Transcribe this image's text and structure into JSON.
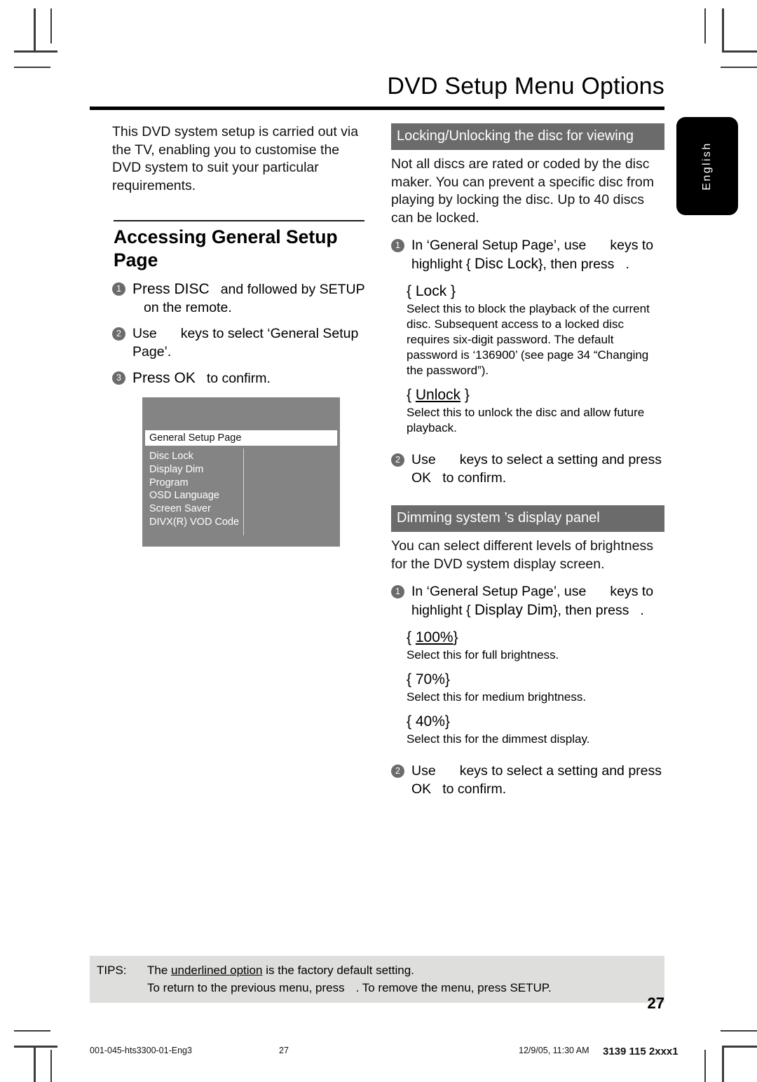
{
  "header": {
    "title": "DVD Setup Menu Options"
  },
  "language_tab": {
    "label": "English"
  },
  "left_column": {
    "intro": "This DVD system setup is carried out via the TV, enabling you to customise the DVD system to suit your particular requirements.",
    "section_heading": "Accessing General Setup Page",
    "steps": [
      {
        "num": "1",
        "pre": "Press DISC",
        "mid": "and followed by SETUP",
        "post": "on the remote."
      },
      {
        "num": "2",
        "pre": "Use",
        "mid": "",
        "post": "keys to select ‘General Setup Page’."
      },
      {
        "num": "3",
        "pre": "Press OK",
        "mid": "",
        "post": "to confirm."
      }
    ]
  },
  "osd_screen": {
    "title": "General Setup Page",
    "items": [
      "Disc Lock",
      "Display Dim",
      "Program",
      "OSD Language",
      "Screen Saver",
      "DIVX(R) VOD Code"
    ]
  },
  "right_column": {
    "section_lock": {
      "banner": "Locking/Unlocking the disc for viewing",
      "intro": "Not all discs are rated or coded by the disc maker. You can prevent a specific disc from playing by locking the disc.  Up to 40 discs can be locked.",
      "step1_a": "In ‘General Setup Page’, use",
      "step1_b": "keys to highlight {",
      "step1_key": "Disc Lock",
      "step1_c": "}, then press",
      "step1_d": ".",
      "options": [
        {
          "label": "Lock",
          "underlined": false,
          "desc": "Select this to block the playback of the current disc.  Subsequent access to a locked disc requires six-digit password. The default password is ‘136900’ (see page 34 “Changing the password”)."
        },
        {
          "label": "Unlock",
          "underlined": true,
          "desc": "Select this to unlock the disc and allow future playback."
        }
      ],
      "step2_a": "Use",
      "step2_b": "keys to select a setting and press OK",
      "step2_c": "to confirm."
    },
    "section_dim": {
      "banner": "Dimming system ’s display panel",
      "intro": "You can select different levels of brightness for the DVD system display screen.",
      "step1_a": "In ‘General Setup Page’, use",
      "step1_b": "keys to highlight {",
      "step1_key": "Display Dim",
      "step1_c": "}, then press",
      "step1_d": ".",
      "options": [
        {
          "label": "100%",
          "underlined": true,
          "desc": "Select this for full brightness."
        },
        {
          "label": "70%",
          "underlined": false,
          "desc": "Select this for medium brightness."
        },
        {
          "label": "40%",
          "underlined": false,
          "desc": "Select this for the dimmest display."
        }
      ],
      "step2_a": "Use",
      "step2_b": "keys to select a setting and press OK",
      "step2_c": "to confirm."
    }
  },
  "tips": {
    "label": "TIPS:",
    "line1_a": "The",
    "line1_underlined": "underlined option",
    "line1_b": "is the factory default setting.",
    "line2_a": "To return to the previous menu, press",
    "line2_b": ". To remove the menu, press SETUP",
    "line2_c": "."
  },
  "page_number": "27",
  "footer": {
    "file_name": "001-045-hts3300-01-Eng3",
    "page": "27",
    "timestamp": "12/9/05, 11:30 AM",
    "doc_code": "3139 115 2xxx1"
  }
}
